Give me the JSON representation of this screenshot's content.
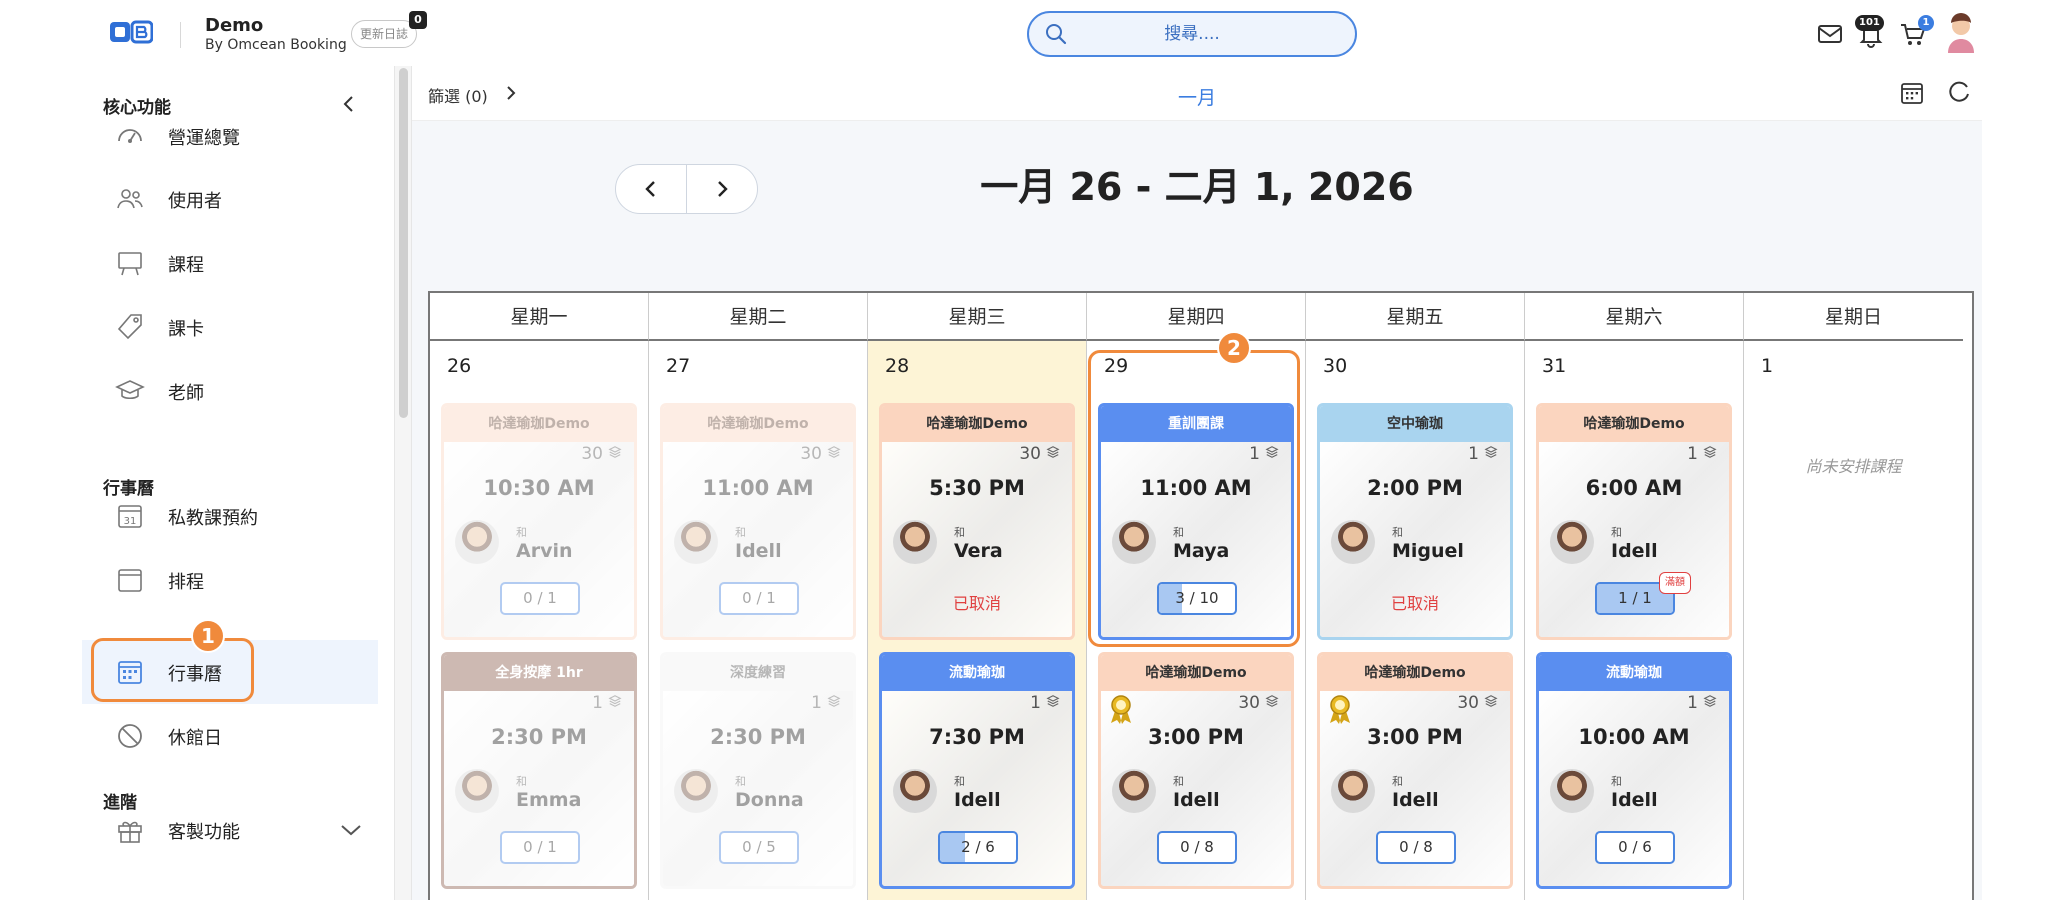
{
  "brand": {
    "name": "Demo",
    "sub": "By Omcean Booking",
    "changelog": "更新日誌",
    "changelog_badge": "0",
    "accent": "#4a86e0"
  },
  "header": {
    "search_placeholder": "搜尋....",
    "notifications_badge": "101",
    "cart_badge": "1"
  },
  "sidebar": {
    "sections": {
      "core": "核心功能",
      "calendar": "行事曆",
      "advanced": "進階"
    },
    "items": [
      {
        "label": "營運總覽",
        "icon": "dashboard-icon"
      },
      {
        "label": "使用者",
        "icon": "users-icon"
      },
      {
        "label": "課程",
        "icon": "class-icon"
      },
      {
        "label": "課卡",
        "icon": "tag-icon"
      },
      {
        "label": "老師",
        "icon": "teacher-icon"
      },
      {
        "label": "私教課預約",
        "icon": "calendar-31-icon"
      },
      {
        "label": "排程",
        "icon": "schedule-icon"
      },
      {
        "label": "行事曆",
        "icon": "calendar-icon",
        "active": true
      },
      {
        "label": "休館日",
        "icon": "ban-icon"
      },
      {
        "label": "客製功能",
        "icon": "gift-icon"
      }
    ]
  },
  "toolbar": {
    "filter": "篩選 (0)",
    "view": "一月"
  },
  "week": {
    "title": "一月 26 - 二月 1, 2026"
  },
  "callouts": {
    "one": "1",
    "two": "2"
  },
  "days": [
    {
      "dow": "星期一",
      "num": "26",
      "highlight": false,
      "empty": "",
      "classes": [
        {
          "title": "哈達瑜珈Demo",
          "cap": "30",
          "time": "10:30 AM",
          "with": "和",
          "teacher": "Arvin",
          "count": "0 / 1",
          "fill": 0,
          "color": "#fbd5bf",
          "tcolor": "#6a4a3a",
          "faded": true,
          "canceled": "",
          "medal": false,
          "waitlist": ""
        },
        {
          "title": "全身按摩 1hr",
          "cap": "1",
          "time": "2:30 PM",
          "with": "和",
          "teacher": "Emma",
          "count": "0 / 1",
          "fill": 0,
          "color": "#8a5a4a",
          "tcolor": "#ffffff",
          "faded": true,
          "canceled": "",
          "medal": false,
          "waitlist": ""
        }
      ]
    },
    {
      "dow": "星期二",
      "num": "27",
      "highlight": false,
      "empty": "",
      "classes": [
        {
          "title": "哈達瑜珈Demo",
          "cap": "30",
          "time": "11:00 AM",
          "with": "和",
          "teacher": "Idell",
          "count": "0 / 1",
          "fill": 0,
          "color": "#fbd5bf",
          "tcolor": "#6a4a3a",
          "faded": true,
          "canceled": "",
          "medal": false,
          "waitlist": ""
        },
        {
          "title": "深度練習 ",
          "cap": "1",
          "time": "2:30 PM",
          "with": "和",
          "teacher": "Donna",
          "count": "0 / 5",
          "fill": 0,
          "color": "#f2f2f2",
          "tcolor": "#555555",
          "faded": true,
          "canceled": "",
          "medal": false,
          "waitlist": ""
        }
      ]
    },
    {
      "dow": "星期三",
      "num": "28",
      "highlight": true,
      "empty": "",
      "classes": [
        {
          "title": "哈達瑜珈Demo",
          "cap": "30",
          "time": "5:30 PM",
          "with": "和",
          "teacher": "Vera",
          "count": "",
          "fill": 0,
          "color": "#fbd5bf",
          "tcolor": "#333333",
          "faded": false,
          "canceled": "已取消",
          "medal": false,
          "waitlist": ""
        },
        {
          "title": "流動瑜珈",
          "cap": "1",
          "time": "7:30 PM",
          "with": "和",
          "teacher": "Idell",
          "count": "2 / 6",
          "fill": 0.333,
          "color": "#5a8ef0",
          "tcolor": "#ffffff",
          "faded": false,
          "canceled": "",
          "medal": false,
          "waitlist": ""
        }
      ]
    },
    {
      "dow": "星期四",
      "num": "29",
      "highlight": false,
      "empty": "",
      "classes": [
        {
          "title": "重訓團課",
          "cap": "1",
          "time": "11:00 AM",
          "with": "和",
          "teacher": "Maya",
          "count": "3 / 10",
          "fill": 0.3,
          "color": "#5a8ef0",
          "tcolor": "#ffffff",
          "faded": false,
          "canceled": "",
          "medal": false,
          "waitlist": ""
        },
        {
          "title": "哈達瑜珈Demo",
          "cap": "30",
          "time": "3:00 PM",
          "with": "和",
          "teacher": "Idell",
          "count": "0 / 8",
          "fill": 0,
          "color": "#fbd5bf",
          "tcolor": "#333333",
          "faded": false,
          "canceled": "",
          "medal": true,
          "waitlist": ""
        }
      ]
    },
    {
      "dow": "星期五",
      "num": "30",
      "highlight": false,
      "empty": "",
      "classes": [
        {
          "title": "空中瑜珈",
          "cap": "1",
          "time": "2:00 PM",
          "with": "和",
          "teacher": "Miguel",
          "count": "",
          "fill": 0,
          "color": "#a9d4ef",
          "tcolor": "#333333",
          "faded": false,
          "canceled": "已取消",
          "medal": false,
          "waitlist": ""
        },
        {
          "title": "哈達瑜珈Demo",
          "cap": "30",
          "time": "3:00 PM",
          "with": "和",
          "teacher": "Idell",
          "count": "0 / 8",
          "fill": 0,
          "color": "#fbd5bf",
          "tcolor": "#333333",
          "faded": false,
          "canceled": "",
          "medal": true,
          "waitlist": ""
        }
      ]
    },
    {
      "dow": "星期六",
      "num": "31",
      "highlight": false,
      "empty": "",
      "classes": [
        {
          "title": "哈達瑜珈Demo",
          "cap": "1",
          "time": "6:00 AM",
          "with": "和",
          "teacher": "Idell",
          "count": "1 / 1",
          "fill": 1,
          "color": "#fbd5bf",
          "tcolor": "#333333",
          "faded": false,
          "canceled": "",
          "medal": false,
          "waitlist": "滿額"
        },
        {
          "title": "流動瑜珈",
          "cap": "1",
          "time": "10:00 AM",
          "with": "和",
          "teacher": "Idell",
          "count": "0 / 6",
          "fill": 0,
          "color": "#5a8ef0",
          "tcolor": "#ffffff",
          "faded": false,
          "canceled": "",
          "medal": false,
          "waitlist": ""
        }
      ]
    },
    {
      "dow": "星期日",
      "num": "1",
      "highlight": false,
      "empty": "尚未安排課程",
      "classes": []
    }
  ]
}
